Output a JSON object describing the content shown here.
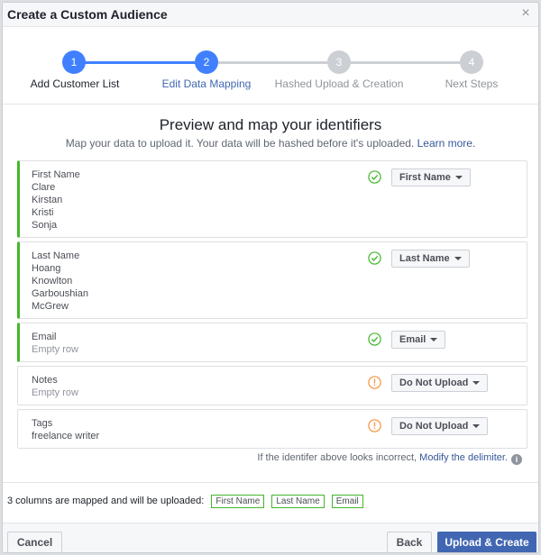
{
  "dialog": {
    "title": "Create a Custom Audience",
    "close_label": "×"
  },
  "stepper": {
    "steps": [
      {
        "number": "1",
        "label": "Add Customer List",
        "state": "done"
      },
      {
        "number": "2",
        "label": "Edit Data Mapping",
        "state": "current"
      },
      {
        "number": "3",
        "label": "Hashed Upload & Creation",
        "state": "upcoming"
      },
      {
        "number": "4",
        "label": "Next Steps",
        "state": "upcoming"
      }
    ]
  },
  "main": {
    "title": "Preview and map your identifiers",
    "subtitle": "Map your data to upload it. Your data will be hashed before it's uploaded.",
    "learn_more": "Learn more."
  },
  "rows": [
    {
      "lines": [
        "First Name",
        "Clare",
        "Kirstan",
        "Kristi",
        "Sonja"
      ],
      "status": "check",
      "mapping": "First Name"
    },
    {
      "lines": [
        "Last Name",
        "Hoang",
        "Knowlton",
        "Garboushian",
        "McGrew"
      ],
      "status": "check",
      "mapping": "Last Name"
    },
    {
      "lines": [
        "Email",
        "Empty row"
      ],
      "status": "check",
      "mapping": "Email"
    },
    {
      "lines": [
        "Notes",
        "Empty row"
      ],
      "status": "warning",
      "mapping": "Do Not Upload"
    },
    {
      "lines": [
        "Tags",
        "freelance writer"
      ],
      "status": "warning",
      "mapping": "Do Not Upload"
    }
  ],
  "delimiter_note": {
    "text": "If the identifer above looks incorrect,",
    "link": "Modify the delimiter.",
    "icon": "info-icon"
  },
  "summary": {
    "text": "3 columns are mapped and will be uploaded:",
    "chips": [
      "First Name",
      "Last Name",
      "Email"
    ]
  },
  "footer": {
    "cancel_label": "Cancel",
    "back_label": "Back",
    "primary_label": "Upload & Create"
  },
  "colors": {
    "accent": "#4080ff",
    "primary_button": "#4267b2",
    "mapped": "#42b72a",
    "warning": "#f7923b"
  }
}
